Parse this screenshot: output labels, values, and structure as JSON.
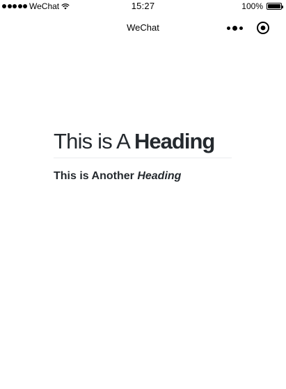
{
  "status_bar": {
    "carrier": "WeChat",
    "time": "15:27",
    "battery": "100%",
    "signal_icon": "signal-dots-icon",
    "wifi_icon": "wifi-icon",
    "battery_icon": "battery-icon"
  },
  "nav_bar": {
    "title": "WeChat",
    "menu_icon": "more-dots-icon",
    "close_icon": "target-close-icon"
  },
  "content": {
    "heading1": {
      "plain": "This is A ",
      "bold": "Heading"
    },
    "heading2": {
      "plain": "This is Another ",
      "italic": "Heading"
    }
  },
  "colors": {
    "text": "#24292e",
    "divider": "#eaecef",
    "background": "#ffffff"
  }
}
